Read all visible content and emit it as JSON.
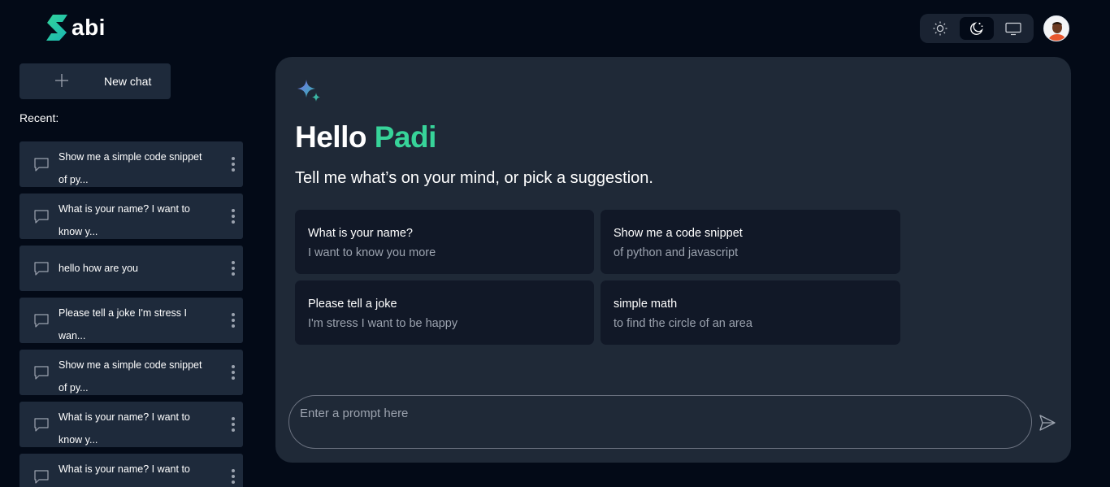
{
  "brand": {
    "logo_text": "abi"
  },
  "header": {
    "theme_options": [
      {
        "name": "light",
        "icon": "sun-icon",
        "active": false
      },
      {
        "name": "dark",
        "icon": "moon-icon",
        "active": true
      },
      {
        "name": "system",
        "icon": "monitor-icon",
        "active": false
      }
    ],
    "avatar": "user-avatar"
  },
  "sidebar": {
    "new_chat_label": "New chat",
    "recent_label": "Recent:",
    "recent_items": [
      {
        "text": "Show me a simple code snippet of py..."
      },
      {
        "text": "What is your name? I want to know y..."
      },
      {
        "text": "hello how are you"
      },
      {
        "text": "Please tell a joke I'm stress I wan..."
      },
      {
        "text": "Show me a simple code snippet of py..."
      },
      {
        "text": "What is your name? I want to know y..."
      },
      {
        "text": "What is your name? I want to know y..."
      }
    ]
  },
  "main": {
    "greeting_prefix": "Hello ",
    "greeting_name": "Padi",
    "tagline": "Tell me what’s on your mind, or pick a suggestion.",
    "suggestions": [
      {
        "title": "What is your name?",
        "subtitle": "I want to know you more"
      },
      {
        "title": "Show me a code snippet",
        "subtitle": "of python and javascript"
      },
      {
        "title": "Please tell a joke",
        "subtitle": "I'm stress I want to be happy"
      },
      {
        "title": "simple math",
        "subtitle": "to find the circle of an area"
      }
    ],
    "prompt_placeholder": "Enter a prompt here"
  },
  "colors": {
    "background": "#030a17",
    "panel": "#1f2937",
    "card": "#111827",
    "accent": "#37d399",
    "sidebar_item": "#1e2a3b"
  }
}
